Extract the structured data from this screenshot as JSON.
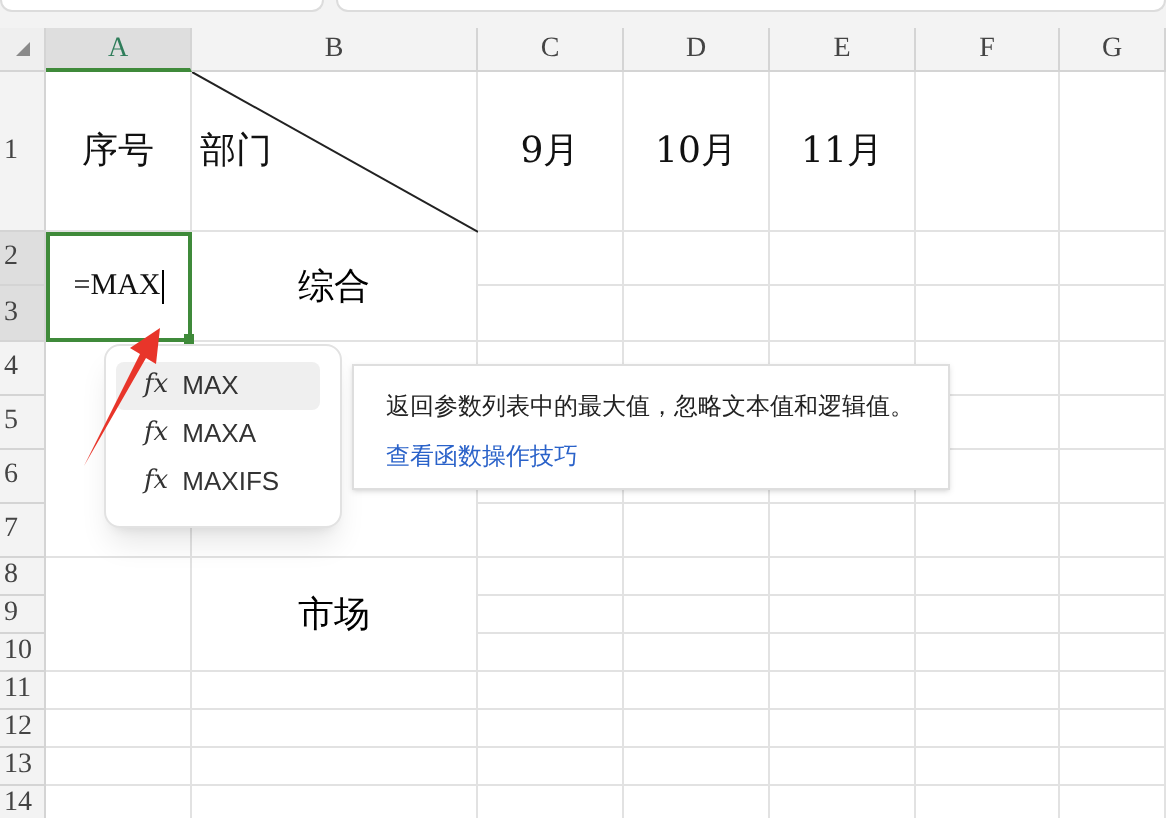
{
  "columns": [
    {
      "label": "A",
      "selected": true
    },
    {
      "label": "B",
      "selected": false
    },
    {
      "label": "C",
      "selected": false
    },
    {
      "label": "D",
      "selected": false
    },
    {
      "label": "E",
      "selected": false
    },
    {
      "label": "F",
      "selected": false
    },
    {
      "label": "G",
      "selected": false
    }
  ],
  "rows": [
    {
      "label": "1",
      "selected": false
    },
    {
      "label": "2",
      "selected": true
    },
    {
      "label": "3",
      "selected": true
    },
    {
      "label": "4",
      "selected": false
    },
    {
      "label": "5",
      "selected": false
    },
    {
      "label": "6",
      "selected": false
    },
    {
      "label": "7",
      "selected": false
    },
    {
      "label": "8",
      "selected": false
    },
    {
      "label": "9",
      "selected": false
    },
    {
      "label": "10",
      "selected": false
    },
    {
      "label": "11",
      "selected": false
    },
    {
      "label": "12",
      "selected": false
    },
    {
      "label": "13",
      "selected": false
    },
    {
      "label": "14",
      "selected": false
    }
  ],
  "header_row": [
    "序号",
    "部门",
    "9月",
    "10月",
    "11月"
  ],
  "editing_cell": {
    "value": "=MAX"
  },
  "merged_cells": [
    {
      "text": "综合"
    },
    {
      "text": "市场"
    }
  ],
  "autocomplete": {
    "items": [
      {
        "icon": "fx",
        "label": "MAX",
        "selected": true
      },
      {
        "icon": "fx",
        "label": "MAXA",
        "selected": false
      },
      {
        "icon": "fx",
        "label": "MAXIFS",
        "selected": false
      }
    ]
  },
  "tooltip": {
    "description": "返回参数列表中的最大值，忽略文本值和逻辑值。",
    "link": "查看函数操作技巧"
  }
}
